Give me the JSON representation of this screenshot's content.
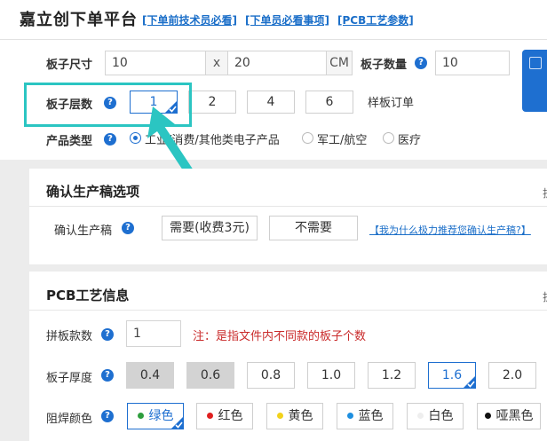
{
  "header": {
    "brand": "嘉立创下单平台",
    "links": [
      "[下单前技术员必看]",
      "[下单员必看事项]",
      "[PCB工艺参数]"
    ]
  },
  "board_size": {
    "label": "板子尺寸",
    "width": "10",
    "separator": "x",
    "height": "20",
    "unit": "CM"
  },
  "board_qty": {
    "label": "板子数量",
    "value": "10"
  },
  "layers": {
    "label": "板子层数",
    "options": [
      "1",
      "2",
      "4",
      "6"
    ],
    "selected": "1",
    "sample_order": "样板订单"
  },
  "product_type": {
    "label": "产品类型",
    "options": [
      "工业/消费/其他类电子产品",
      "军工/航空",
      "医疗"
    ],
    "selected": "工业/消费/其他类电子产品"
  },
  "confirm": {
    "title": "确认生产稿选项",
    "corner": "折",
    "label": "确认生产稿",
    "options": [
      "需要(收费3元)",
      "不需要"
    ],
    "reason_link": "【我为什么极力推荐您确认生产稿?】"
  },
  "pcb": {
    "title": "PCB工艺信息",
    "corner": "折",
    "panel": {
      "label": "拼板款数",
      "value": "1",
      "note": "注：是指文件内不同款的板子个数"
    },
    "thickness": {
      "label": "板子厚度",
      "options": [
        "0.4",
        "0.6",
        "0.8",
        "1.0",
        "1.2",
        "1.6",
        "2.0"
      ],
      "disabled": [
        "0.4",
        "0.6"
      ],
      "selected": "1.6"
    },
    "solder_mask": {
      "label": "阻焊颜色",
      "options": [
        {
          "name": "绿色",
          "color": "#2e9e3e"
        },
        {
          "name": "红色",
          "color": "#e02020"
        },
        {
          "name": "黄色",
          "color": "#f2d21b"
        },
        {
          "name": "蓝色",
          "color": "#1e8fe0"
        },
        {
          "name": "白色",
          "color": "#eeeeee"
        },
        {
          "name": "哑黑色",
          "color": "#111111"
        }
      ],
      "selected": "绿色"
    }
  },
  "colors": {
    "accent": "#1e6fd0",
    "highlight": "#2bc5c2",
    "note_red": "#c92a2a"
  }
}
